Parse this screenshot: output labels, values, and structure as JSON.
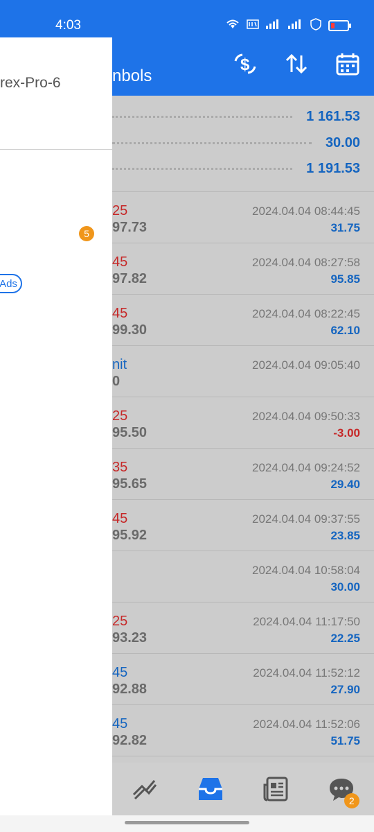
{
  "status_bar": {
    "time": "4:03"
  },
  "app_bar": {
    "title": "nbols"
  },
  "colors": {
    "accent": "#1e73e8",
    "profit_blue": "#1565c0",
    "loss_red": "#c62828",
    "badge_orange": "#f0961b"
  },
  "summary": {
    "values": [
      "1 161.53",
      "30.00",
      "1 191.53"
    ]
  },
  "deals": [
    {
      "top": "25",
      "top_color": "#c62828",
      "bottom": "97.73",
      "time": "2024.04.04 08:44:45",
      "amount": "31.75",
      "amount_color": "#1565c0"
    },
    {
      "top": "45",
      "top_color": "#c62828",
      "bottom": "97.82",
      "time": "2024.04.04 08:27:58",
      "amount": "95.85",
      "amount_color": "#1565c0"
    },
    {
      "top": "45",
      "top_color": "#c62828",
      "bottom": "99.30",
      "time": "2024.04.04 08:22:45",
      "amount": "62.10",
      "amount_color": "#1565c0"
    },
    {
      "top": "nit",
      "top_color": "#1565c0",
      "bottom": "0",
      "time": "2024.04.04 09:05:40",
      "amount": "",
      "amount_color": "#1565c0"
    },
    {
      "top": "25",
      "top_color": "#c62828",
      "bottom": "95.50",
      "time": "2024.04.04 09:50:33",
      "amount": "-3.00",
      "amount_color": "#c62828"
    },
    {
      "top": "35",
      "top_color": "#c62828",
      "bottom": "95.65",
      "time": "2024.04.04 09:24:52",
      "amount": "29.40",
      "amount_color": "#1565c0"
    },
    {
      "top": "45",
      "top_color": "#c62828",
      "bottom": "95.92",
      "time": "2024.04.04 09:37:55",
      "amount": "23.85",
      "amount_color": "#1565c0"
    },
    {
      "top": "",
      "top_color": "#c62828",
      "bottom": "",
      "time": "2024.04.04 10:58:04",
      "amount": "30.00",
      "amount_color": "#1565c0"
    },
    {
      "top": "25",
      "top_color": "#c62828",
      "bottom": "93.23",
      "time": "2024.04.04 11:17:50",
      "amount": "22.25",
      "amount_color": "#1565c0"
    },
    {
      "top": "45",
      "top_color": "#1565c0",
      "bottom": "92.88",
      "time": "2024.04.04 11:52:12",
      "amount": "27.90",
      "amount_color": "#1565c0"
    },
    {
      "top": "45",
      "top_color": "#1565c0",
      "bottom": "92.82",
      "time": "2024.04.04 11:52:06",
      "amount": "51.75",
      "amount_color": "#1565c0"
    }
  ],
  "drawer": {
    "title": "rex-Pro-6",
    "badge": "5",
    "ads_label": "Ads"
  },
  "bottom_nav": {
    "chat_badge": "2"
  }
}
